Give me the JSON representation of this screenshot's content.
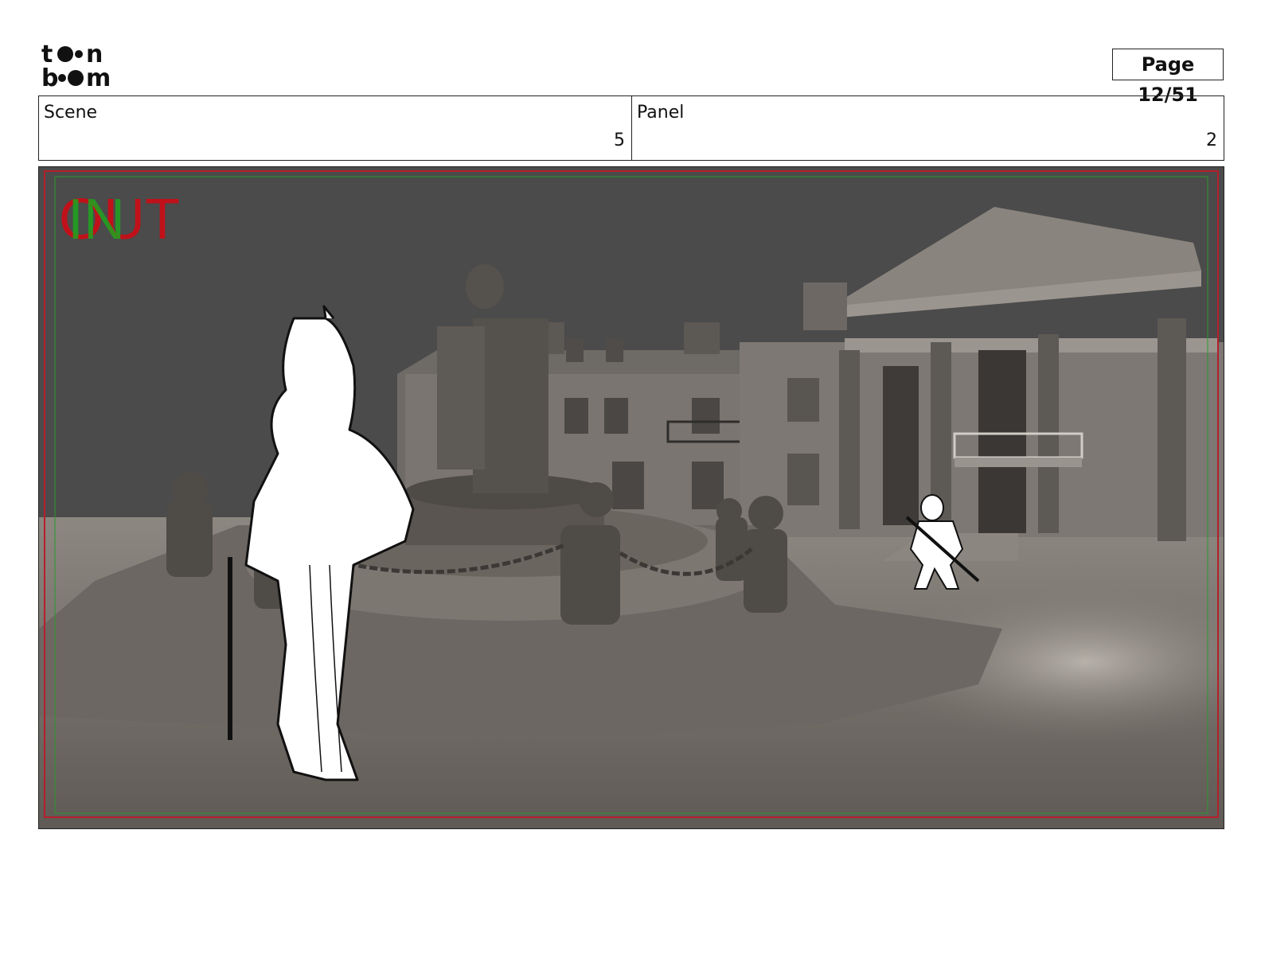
{
  "header": {
    "logo_text": [
      "toon",
      "boom"
    ],
    "page_label": "Page 12/51"
  },
  "info": {
    "scene_label": "Scene",
    "scene_value": "5",
    "panel_label": "Panel",
    "panel_value": "2"
  },
  "panel_image": {
    "overlay_text": "OUT",
    "overlay_text_color": "#c0111a",
    "overlay_accent_color": "#1ea51e",
    "safe_frame_color": "#b51f2a",
    "title_safe_color": "#2b9a2b",
    "sky_color": "#4b4b4b",
    "ground_color": "#77716a"
  }
}
